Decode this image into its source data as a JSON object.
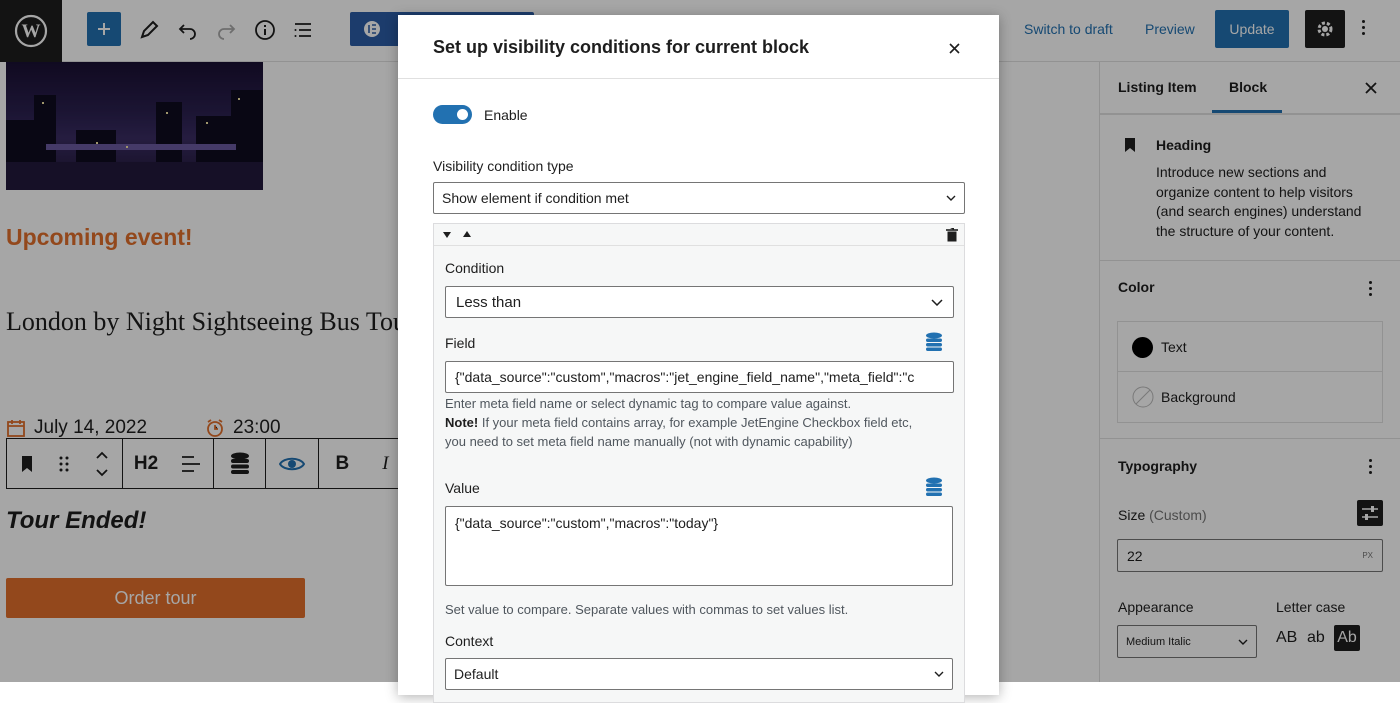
{
  "topbar": {
    "switch_to_draft": "Switch to draft",
    "preview": "Preview",
    "update": "Update"
  },
  "editor": {
    "heading_upcoming": "Upcoming event!",
    "post_title": "London by Night Sightseeing Bus Tour",
    "date": "July 14, 2022",
    "time": "23:00",
    "heading_level": "H2",
    "tour_ended": "Tour Ended!",
    "order_button": "Order tour"
  },
  "modal": {
    "title": "Set up visibility conditions for current block",
    "enable_label": "Enable",
    "enable_on": true,
    "visibility_type_label": "Visibility condition type",
    "visibility_type_value": "Show element if condition met",
    "condition_label": "Condition",
    "condition_value": "Less than",
    "field_label": "Field",
    "field_value": "{\"data_source\":\"custom\",\"macros\":\"jet_engine_field_name\",\"meta_field\":\"c",
    "field_help": "Enter meta field name or select dynamic tag to compare value against.",
    "field_note_bold": "Note!",
    "field_note_1": " If your meta field contains array, for example JetEngine Checkbox field etc,",
    "field_note_2": "you need to set meta field name manually (not with dynamic capability)",
    "value_label": "Value",
    "value_value": "{\"data_source\":\"custom\",\"macros\":\"today\"}",
    "value_help": "Set value to compare. Separate values with commas to set values list.",
    "context_label": "Context",
    "context_value": "Default"
  },
  "sidebar": {
    "tab_listing": "Listing Item",
    "tab_block": "Block",
    "block_name": "Heading",
    "block_desc_1": "Introduce new sections and",
    "block_desc_2": "organize content to help visitors",
    "block_desc_3": "(and search engines) understand",
    "block_desc_4": "the structure of your content.",
    "color_heading": "Color",
    "color_text": "Text",
    "color_background": "Background",
    "typography_heading": "Typography",
    "size_label": "Size",
    "size_custom": "(Custom)",
    "size_value": "22",
    "size_unit": "PX",
    "appearance_label": "Appearance",
    "appearance_value": "Medium Italic",
    "letter_case_label": "Letter case",
    "case_upper": "AB",
    "case_lower": "ab",
    "case_capital": "Ab"
  },
  "colors": {
    "accent": "#2271b1",
    "orange": "#e26f2b",
    "dark": "#1e1e1e"
  }
}
